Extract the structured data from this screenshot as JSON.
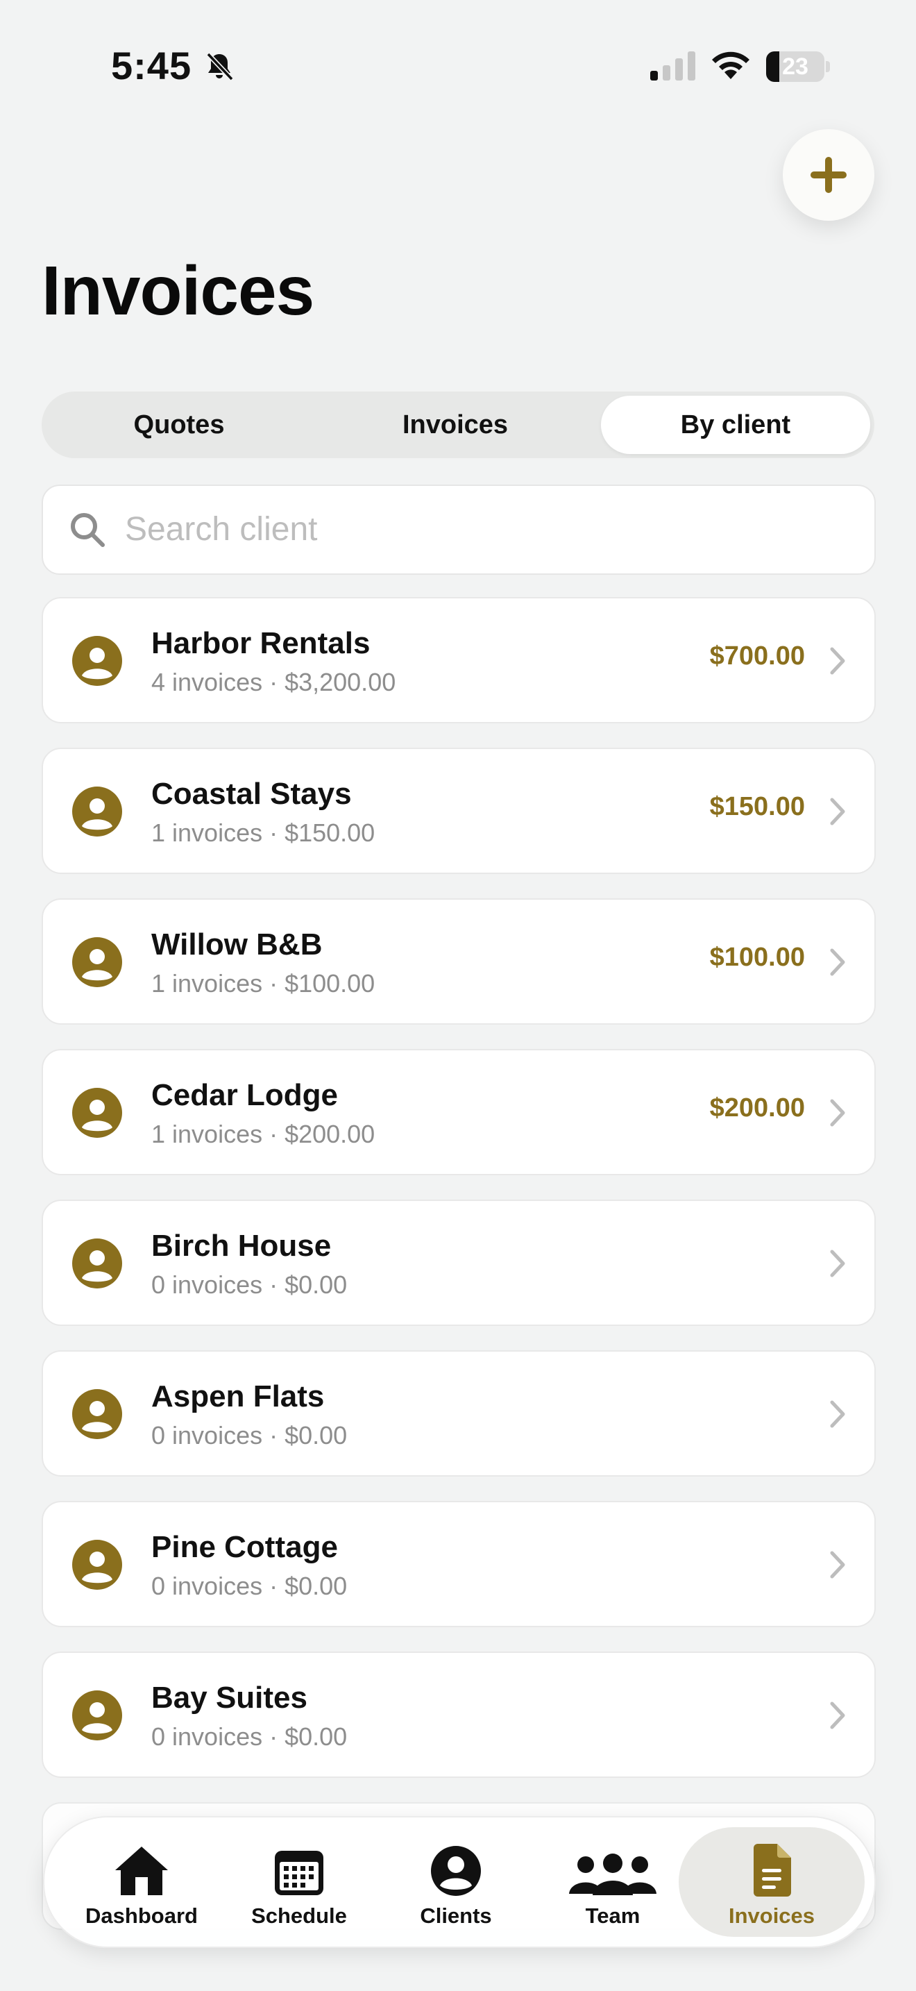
{
  "status_bar": {
    "time": "5:45",
    "battery": "23",
    "battery_level": 0.23
  },
  "page": {
    "title": "Invoices"
  },
  "segments": [
    {
      "label": "Quotes",
      "active": false
    },
    {
      "label": "Invoices",
      "active": false
    },
    {
      "label": "By client",
      "active": true
    }
  ],
  "search": {
    "placeholder": "Search client",
    "value": ""
  },
  "clients": [
    {
      "name": "Harbor Rentals",
      "meta": "4 invoices · $3,200.00",
      "amount": "$700.00"
    },
    {
      "name": "Coastal Stays",
      "meta": "1 invoices · $150.00",
      "amount": "$150.00"
    },
    {
      "name": "Willow B&B",
      "meta": "1 invoices · $100.00",
      "amount": "$100.00"
    },
    {
      "name": "Cedar Lodge",
      "meta": "1 invoices · $200.00",
      "amount": "$200.00"
    },
    {
      "name": "Birch House",
      "meta": "0 invoices · $0.00",
      "amount": ""
    },
    {
      "name": "Aspen Flats",
      "meta": "0 invoices · $0.00",
      "amount": ""
    },
    {
      "name": "Pine Cottage",
      "meta": "0 invoices · $0.00",
      "amount": ""
    },
    {
      "name": "Bay Suites",
      "meta": "0 invoices · $0.00",
      "amount": ""
    }
  ],
  "tabs": [
    {
      "label": "Dashboard",
      "icon": "house-icon",
      "active": false
    },
    {
      "label": "Schedule",
      "icon": "calendar-icon",
      "active": false
    },
    {
      "label": "Clients",
      "icon": "person-icon",
      "active": false
    },
    {
      "label": "Team",
      "icon": "team-icon",
      "active": false
    },
    {
      "label": "Invoices",
      "icon": "document-icon",
      "active": true
    }
  ],
  "colors": {
    "accent": "#8a6f1d",
    "background": "#f2f3f3",
    "muted_text": "#8d8d8d"
  }
}
